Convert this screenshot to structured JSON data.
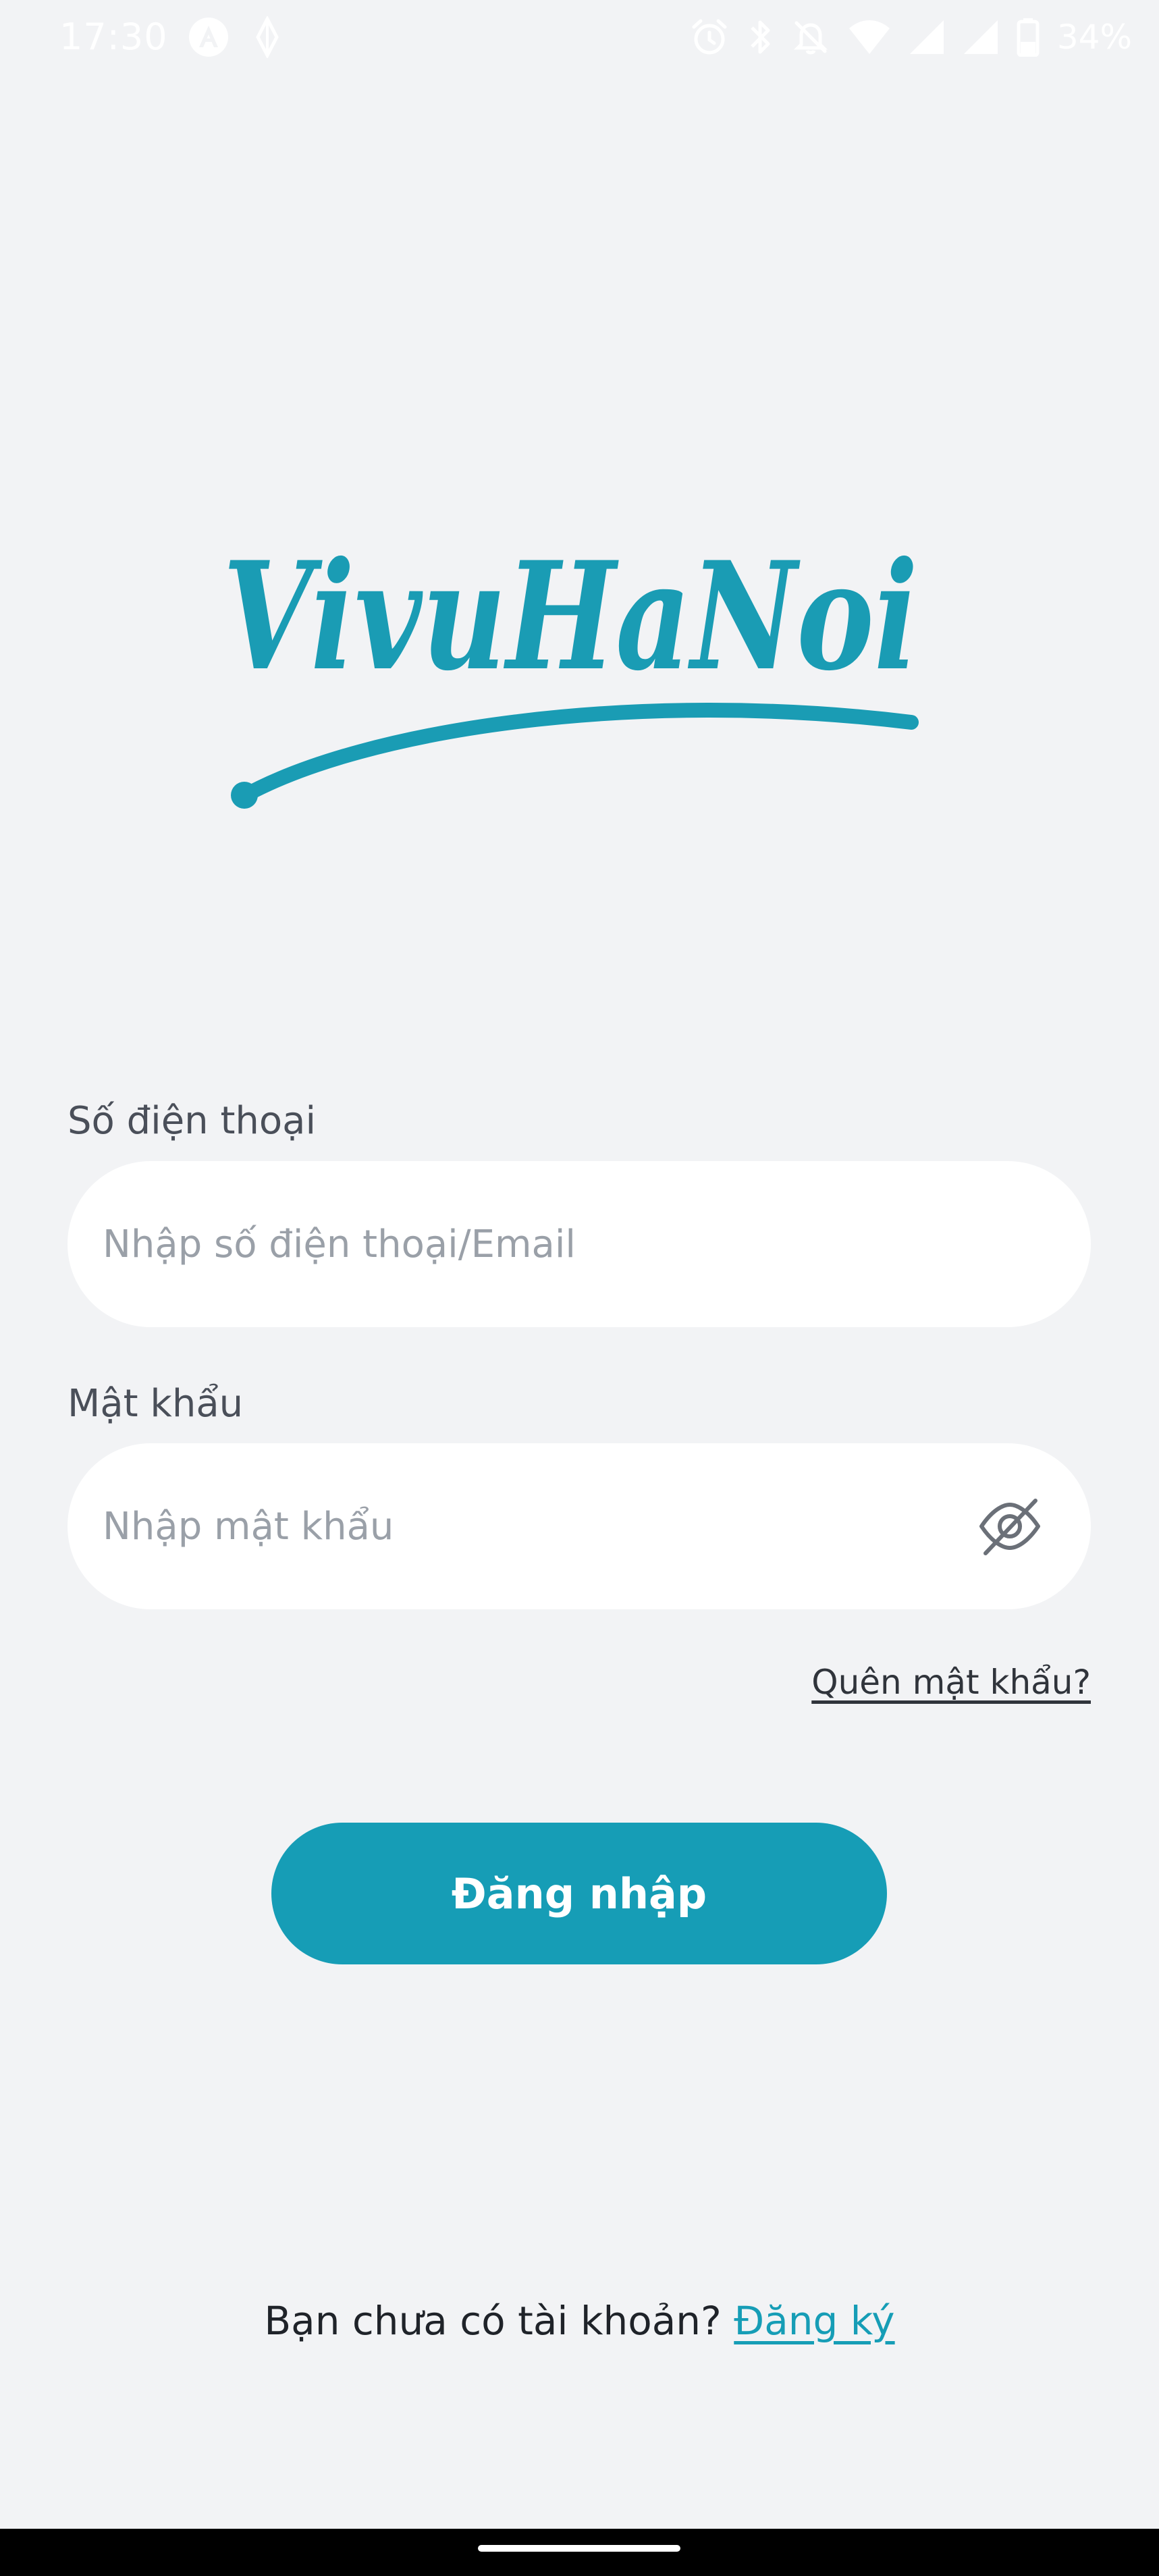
{
  "status_bar": {
    "time": "17:30",
    "battery": "34%",
    "left_icons": [
      "notification-a-icon",
      "diamond-icon"
    ],
    "right_icons": [
      "alarm-icon",
      "bluetooth-icon",
      "bell-off-icon",
      "wifi-icon",
      "signal-icon",
      "signal-icon",
      "battery-icon"
    ]
  },
  "logo": {
    "text": "VivuHaNoi",
    "color": "#1A9CB4"
  },
  "form": {
    "phone": {
      "label": "Số điện thoại",
      "placeholder": "Nhập số điện thoại/Email",
      "value": ""
    },
    "password": {
      "label": "Mật khẩu",
      "placeholder": "Nhập mật khẩu",
      "value": "",
      "toggle_icon": "eye-off-icon"
    },
    "forgot_password": "Quên mật khẩu?",
    "login_button": "Đăng nhập"
  },
  "signup": {
    "prompt": "Bạn chưa có tài khoản?",
    "link": "Đăng ký"
  },
  "colors": {
    "background": "#F2F3F5",
    "accent": "#169DB6",
    "field_bg": "#FFFFFF"
  }
}
